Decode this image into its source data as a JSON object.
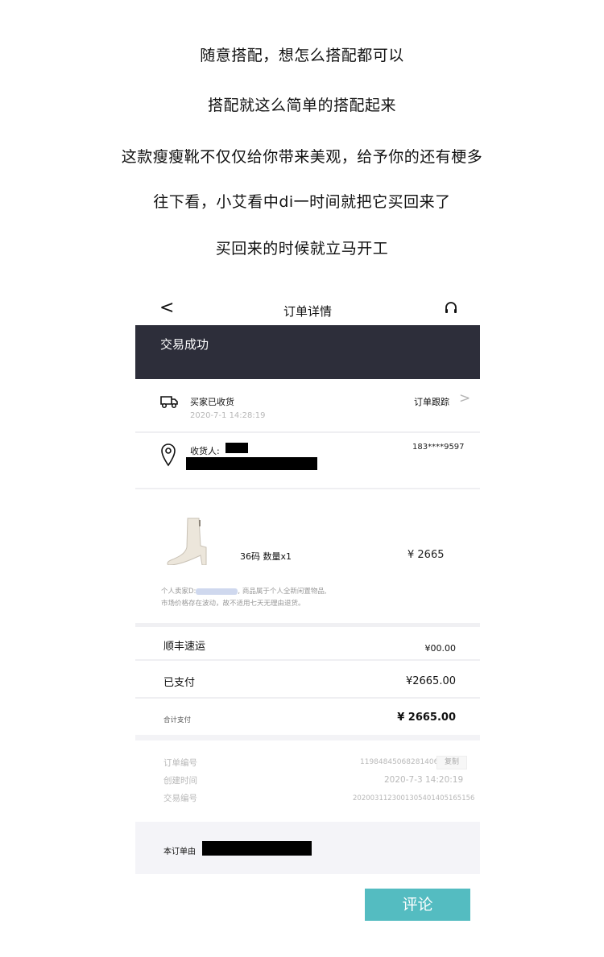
{
  "intro": {
    "line1": "随意搭配，想怎么搭配都可以",
    "line2": "搭配就这么简单的搭配起来",
    "line3": "这款瘦瘦靴不仅仅给你带来美观，给予你的还有梗多",
    "line4": "往下看，小艾看中di一时间就把它买回来了",
    "line5": "买回来的时候就立马开工"
  },
  "nav": {
    "back": "<",
    "title": "订单详情",
    "service_icon": "headset-icon"
  },
  "banner": {
    "status": "交易成功",
    "bg_color": "#2d2e3a"
  },
  "shipping": {
    "status": "买家已收货",
    "time": "2020-7-1 14:28:19",
    "track_label": "订单跟踪",
    "chevron": ">"
  },
  "address": {
    "recipient_label": "收货人:",
    "phone": "183****9597"
  },
  "product": {
    "size_qty": "36码   数量x1",
    "price": "¥ 2665",
    "notice_prefix": "个人卖家D:",
    "notice_suffix": ", 商品属于个人全新闲置物品,",
    "notice_line2": "市场价格存在波动，故不适用七天无理由退货。"
  },
  "costs": {
    "shipping_label": "顺丰速运",
    "shipping_value": "¥00.00",
    "paid_label": "已支付",
    "paid_value": "¥2665.00",
    "total_label": "合计支付",
    "total_value": "¥ 2665.00"
  },
  "order_info": {
    "number_label": "订单编号",
    "number_value": "11984845068281406",
    "copy_label": "复制",
    "created_label": "创建时间",
    "created_value": "2020-7-3  14:20:19",
    "trade_label": "交易编号",
    "trade_value": "20200311230013054014051651​56"
  },
  "footer": {
    "text": "本订单由"
  },
  "review_button": {
    "label": "评论",
    "color": "#54bcc1"
  }
}
